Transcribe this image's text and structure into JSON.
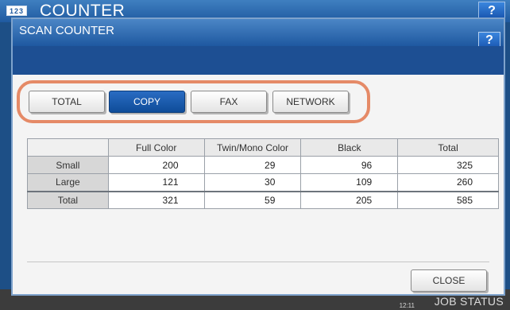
{
  "background": {
    "icon_text": "123",
    "title": "COUNTER",
    "help_label": "?",
    "clock_line1": "",
    "clock_line2": "12:11",
    "job_status_label": "JOB STATUS"
  },
  "dialog": {
    "title": "SCAN COUNTER",
    "help_label": "?",
    "tabs": [
      {
        "label": "TOTAL",
        "active": false
      },
      {
        "label": "COPY",
        "active": true
      },
      {
        "label": "FAX",
        "active": false
      },
      {
        "label": "NETWORK",
        "active": false
      }
    ],
    "table": {
      "headers": [
        "",
        "Full Color",
        "Twin/Mono Color",
        "Black",
        "Total"
      ],
      "rows": [
        {
          "label": "Small",
          "values": [
            "200",
            "29",
            "96",
            "325"
          ]
        },
        {
          "label": "Large",
          "values": [
            "121",
            "30",
            "109",
            "260"
          ]
        },
        {
          "label": "Total",
          "values": [
            "321",
            "59",
            "205",
            "585"
          ]
        }
      ]
    },
    "close_label": "CLOSE"
  },
  "colors": {
    "highlight": "#e58a67",
    "active_tab": "#0e4c99",
    "title_bar": "#1e58a0"
  }
}
